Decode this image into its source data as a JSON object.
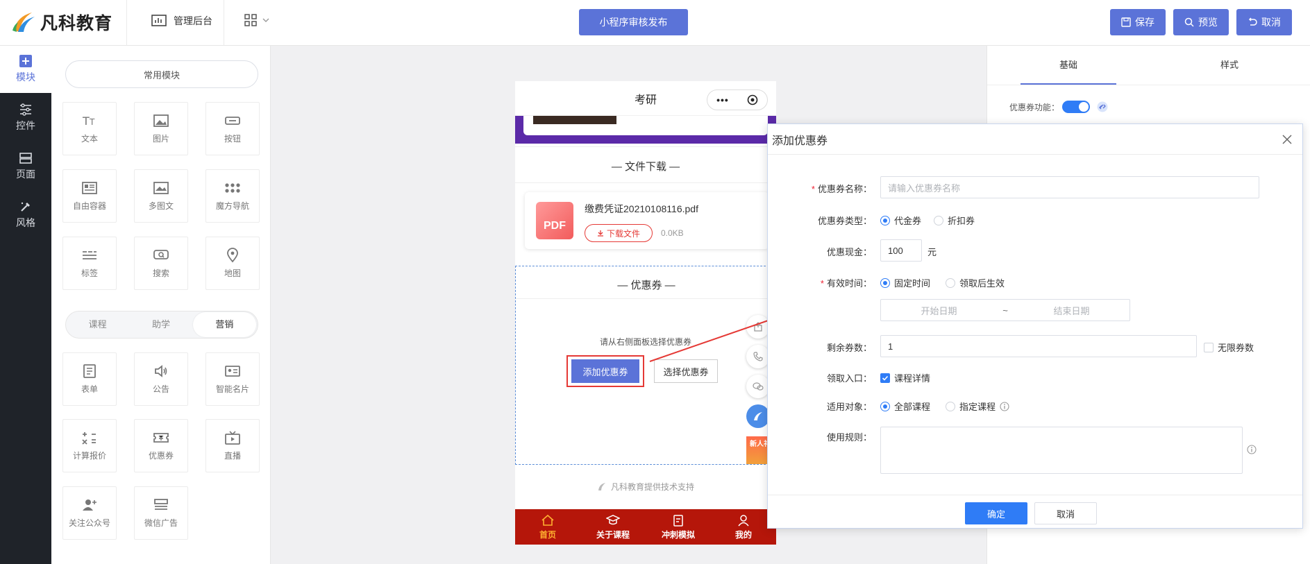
{
  "header": {
    "logo_text": "凡科教育",
    "admin_label": "管理后台",
    "publish_label": "小程序审核发布",
    "save_label": "保存",
    "preview_label": "预览",
    "cancel_label": "取消"
  },
  "leftnav": [
    {
      "label": "模块",
      "icon": "plus-square-icon"
    },
    {
      "label": "控件",
      "icon": "sliders-icon"
    },
    {
      "label": "页面",
      "icon": "pages-icon"
    },
    {
      "label": "风格",
      "icon": "brush-icon"
    }
  ],
  "modules": {
    "common_label": "常用模块",
    "common": [
      {
        "label": "文本",
        "icon": "text-icon"
      },
      {
        "label": "图片",
        "icon": "image-icon"
      },
      {
        "label": "按钮",
        "icon": "button-icon"
      },
      {
        "label": "自由容器",
        "icon": "container-icon"
      },
      {
        "label": "多图文",
        "icon": "multi-image-icon"
      },
      {
        "label": "魔方导航",
        "icon": "dots-grid-icon"
      },
      {
        "label": "标签",
        "icon": "tag-lines-icon"
      },
      {
        "label": "搜索",
        "icon": "search-icon"
      },
      {
        "label": "地图",
        "icon": "map-pin-icon"
      }
    ],
    "segments": [
      "课程",
      "助学",
      "营销"
    ],
    "marketing": [
      {
        "label": "表单",
        "icon": "form-icon"
      },
      {
        "label": "公告",
        "icon": "speaker-icon"
      },
      {
        "label": "智能名片",
        "icon": "card-icon"
      },
      {
        "label": "计算报价",
        "icon": "calculator-icon"
      },
      {
        "label": "优惠券",
        "icon": "coupon-icon"
      },
      {
        "label": "直播",
        "icon": "tv-icon"
      },
      {
        "label": "关注公众号",
        "icon": "user-plus-icon"
      },
      {
        "label": "微信广告",
        "icon": "ad-icon"
      }
    ]
  },
  "phone": {
    "title": "考研",
    "file_section": "文件下载",
    "file_name": "缴费凭证20210108116.pdf",
    "file_badge": "PDF",
    "download_label": "下载文件",
    "file_size": "0.0KB",
    "coupon_section": "优惠券",
    "coupon_hint": "请从右侧面板选择优惠券",
    "add_coupon": "添加优惠券",
    "select_coupon": "选择优惠券",
    "footer_text": "凡科教育提供技术支持",
    "gift_label": "新人礼",
    "tabs": [
      {
        "label": "首页",
        "icon": "home-icon"
      },
      {
        "label": "关于课程",
        "icon": "graduation-cap-icon"
      },
      {
        "label": "冲刺模拟",
        "icon": "clipboard-icon"
      },
      {
        "label": "我的",
        "icon": "user-icon"
      }
    ]
  },
  "rpanel": {
    "tab_basic": "基础",
    "tab_style": "样式",
    "coupon_switch_label": "优惠券功能：",
    "switch_on": true
  },
  "modal": {
    "title": "添加优惠券",
    "name_label": "优惠券名称：",
    "name_placeholder": "请输入优惠券名称",
    "type_label": "优惠券类型：",
    "type_options": [
      "代金券",
      "折扣券"
    ],
    "cash_label": "优惠现金：",
    "cash_value": "100",
    "cash_unit": "元",
    "valid_label": "有效时间：",
    "valid_options": [
      "固定时间",
      "领取后生效"
    ],
    "start_placeholder": "开始日期",
    "date_sep": "~",
    "end_placeholder": "结束日期",
    "remain_label": "剩余券数：",
    "remain_value": "1",
    "unlimited_label": "无限券数",
    "entry_label": "领取入口：",
    "entry_option": "课程详情",
    "target_label": "适用对象：",
    "target_options": [
      "全部课程",
      "指定课程"
    ],
    "rules_label": "使用规则：",
    "ok_label": "确定",
    "cancel_label": "取消"
  },
  "colors": {
    "accent": "#5b73d8",
    "primary_blue": "#2f7cf6",
    "tabbar_red": "#b5160a",
    "purple": "#5b2aa8",
    "annotation_red": "#e53935"
  }
}
